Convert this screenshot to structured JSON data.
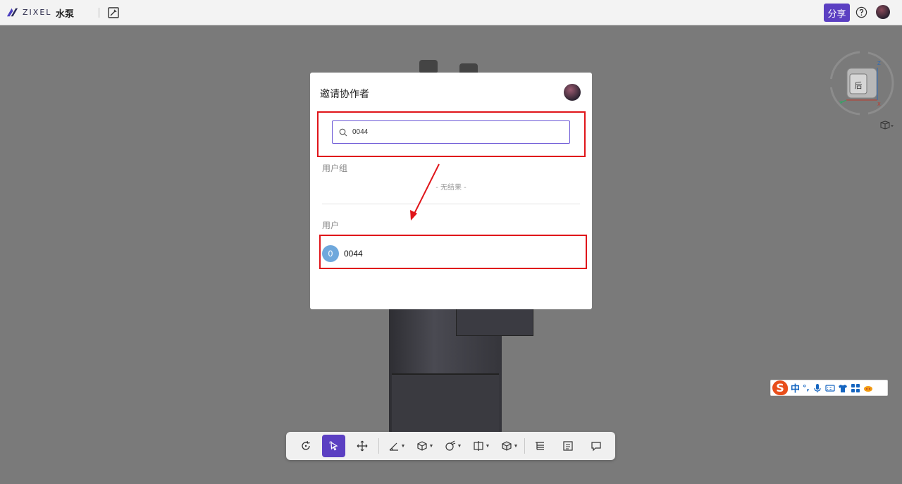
{
  "header": {
    "logo_text": "ZIXEL",
    "doc_title": "水泵",
    "share_label": "分享"
  },
  "viewcube": {
    "face_label": "后",
    "axis_z": "Z",
    "axis_x": "X",
    "axis_y": "Y"
  },
  "modal": {
    "title": "邀请协作者",
    "search": {
      "value": "0044",
      "placeholder": ""
    },
    "groups_label": "用户组",
    "no_result": "- 无结果 -",
    "users_label": "用户",
    "users": [
      {
        "initial": "0",
        "name": "0044"
      }
    ]
  },
  "ime": {
    "logo": "S",
    "mode": "中",
    "punct": "°,"
  },
  "toolbar": {
    "items": [
      "rotate-icon",
      "select-icon",
      "move-icon",
      "measure-icon",
      "section-icon",
      "explode-icon",
      "split-view-icon",
      "render-icon",
      "tree-icon",
      "properties-icon",
      "comment-icon"
    ]
  },
  "colors": {
    "accent": "#5b3fc2",
    "highlight": "#e0151a",
    "overlay": "#7a7a7a",
    "user_avatar": "#6fa8dc"
  }
}
